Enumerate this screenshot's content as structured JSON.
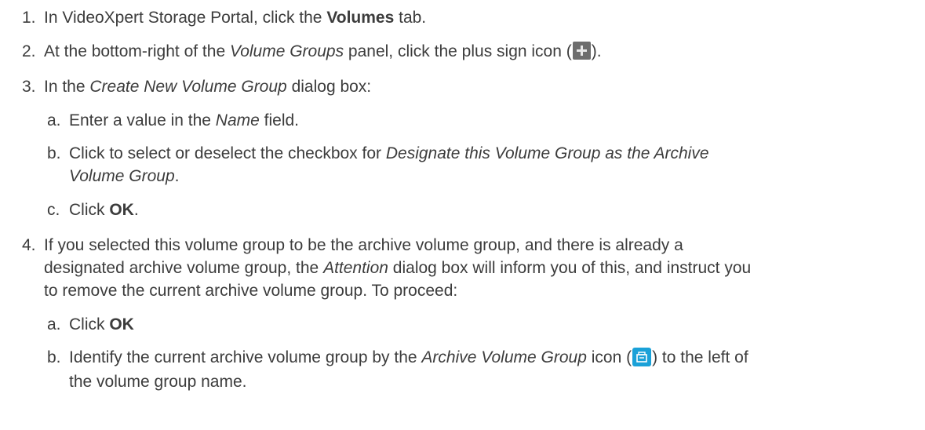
{
  "steps": [
    {
      "num": "1.",
      "pre": "In VideoXpert Storage Portal, click the ",
      "bold": "Volumes",
      "post": " tab."
    },
    {
      "num": "2.",
      "pre": "At the bottom-right of the ",
      "italic": "Volume Groups",
      "mid": " panel, click the plus sign icon (",
      "icon": "plus-icon",
      "post": ")."
    },
    {
      "num": "3.",
      "pre": "In the ",
      "italic": "Create New Volume Group",
      "post": " dialog box:",
      "substeps": [
        {
          "letter": "a.",
          "pre": "Enter a value in the ",
          "italic": "Name",
          "post": " field."
        },
        {
          "letter": "b.",
          "pre": "Click to select or deselect the checkbox for ",
          "italic1": "Designate this Volume Group as the Archive",
          "italic2": "Volume Group",
          "post": "."
        },
        {
          "letter": "c.",
          "pre": "Click ",
          "bold": "OK",
          "post": "."
        }
      ]
    },
    {
      "num": "4.",
      "line1": "If you selected this volume group to be the archive volume group, and there is already a",
      "line2_pre": "designated archive volume group, the ",
      "line2_italic": "Attention",
      "line2_post": " dialog box will inform you of this, and instruct you",
      "line3": "to remove the current archive volume group. To proceed:",
      "substeps": [
        {
          "letter": "a.",
          "pre": "Click ",
          "bold": "OK"
        },
        {
          "letter": "b.",
          "pre": "Identify the current archive volume group by the ",
          "italic": "Archive Volume Group",
          "mid": " icon (",
          "icon": "archive-volume-group-icon",
          "post": ") to the left of",
          "line2": "the volume group name."
        }
      ]
    }
  ],
  "colors": {
    "text": "#3c3c3c",
    "plus_icon_bg": "#6d6d6d",
    "archive_icon_bg": "#1aa1d8"
  }
}
